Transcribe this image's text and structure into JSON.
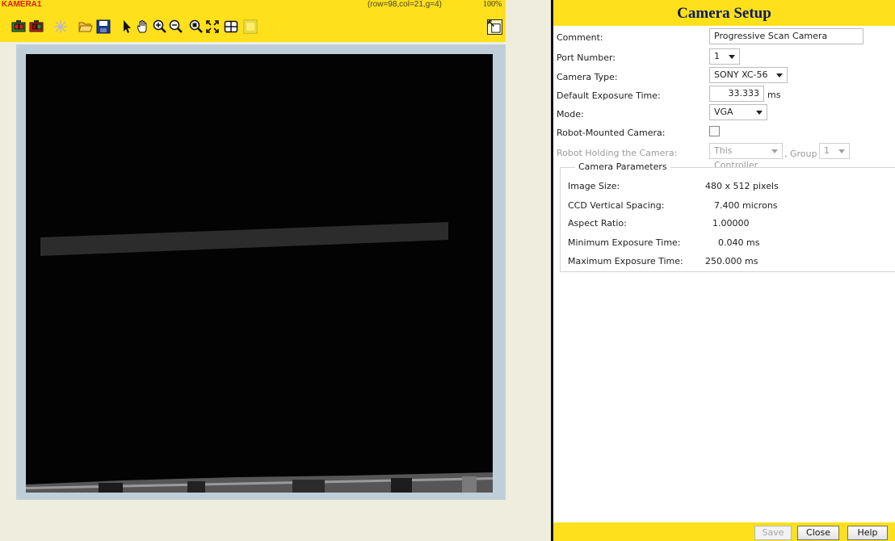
{
  "viewer": {
    "camera_name": "KAMERA1",
    "status": "(row=98,col=21,g=4)",
    "zoom": "100%",
    "toolbar_icons": [
      "snap-icon",
      "live-icon",
      "laser-icon",
      "open-icon",
      "save-icon",
      "pointer-icon",
      "pan-icon",
      "zoom-in-icon",
      "zoom-out-icon",
      "zoom-window-icon",
      "fit-icon",
      "grid-icon",
      "region-icon"
    ]
  },
  "setup": {
    "title": "Camera Setup",
    "comment_label": "Comment:",
    "comment_value": "Progressive Scan Camera",
    "port_label": "Port Number:",
    "port_value": "1",
    "type_label": "Camera Type:",
    "type_value": "SONY XC-56",
    "exposure_label": "Default Exposure Time:",
    "exposure_value": "33.333",
    "exposure_unit": "ms",
    "mode_label": "Mode:",
    "mode_value": "VGA",
    "robot_mounted_label": "Robot-Mounted Camera:",
    "robot_mounted_checked": false,
    "robot_holding_label": "Robot Holding the Camera:",
    "robot_holding_value": "This Controller",
    "group_label": ", Group",
    "group_value": "1",
    "params": {
      "legend": "Camera Parameters",
      "image_size_label": "Image Size:",
      "image_size_value": "480 x 512 pixels",
      "ccd_label": "CCD Vertical Spacing:",
      "ccd_value": "7.400 microns",
      "aspect_label": "Aspect Ratio:",
      "aspect_value": "1.00000",
      "min_exp_label": "Minimum Exposure Time:",
      "min_exp_value": "0.040 ms",
      "max_exp_label": "Maximum Exposure Time:",
      "max_exp_value": "250.000 ms"
    }
  },
  "footer": {
    "save": "Save",
    "close": "Close",
    "help": "Help"
  },
  "colors": {
    "toolbar_bg": "#ffe01a",
    "title_text": "#0c1a5c",
    "camera_name": "#d81e1e",
    "image_border": "#bfcfd9"
  }
}
